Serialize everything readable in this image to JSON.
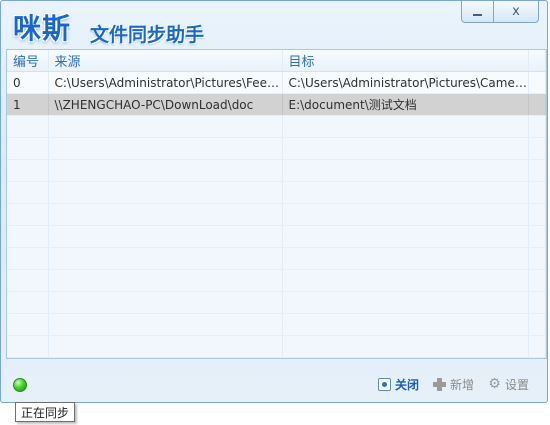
{
  "app": {
    "brand": "咪斯",
    "subtitle": "文件同步助手"
  },
  "window_controls": {
    "close_glyph": "x"
  },
  "table": {
    "headers": {
      "id": "编号",
      "source": "来源",
      "target": "目标"
    },
    "rows": [
      {
        "id": "0",
        "source": "C:\\Users\\Administrator\\Pictures\\Feedback",
        "target": "C:\\Users\\Administrator\\Pictures\\Camera Roll"
      },
      {
        "id": "1",
        "source": "\\\\ZHENGCHAO-PC\\DownLoad\\doc",
        "target": "E:\\document\\测试文档"
      }
    ],
    "selected_row": 1
  },
  "footer": {
    "status_color": "#43d12c",
    "close_label": "关闭",
    "add_label": "新增",
    "settings_label": "设置"
  },
  "tooltip": {
    "text": "正在同步"
  }
}
